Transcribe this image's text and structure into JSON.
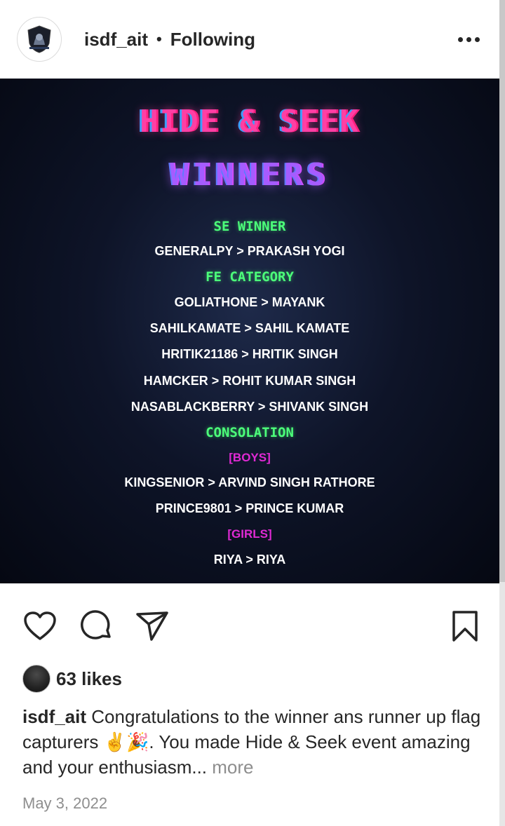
{
  "header": {
    "username": "isdf_ait",
    "separator": "•",
    "follow_status": "Following"
  },
  "post_image": {
    "title_line1": "HIDE & SEEK",
    "title_line2": "WINNERS",
    "colors": {
      "background": "#0e1428",
      "section_heading": "#4cff7a",
      "tag": "#e02ad4",
      "title_pink": "#ff3fa4",
      "title_purple": "#a55cff"
    },
    "lines": [
      {
        "text": "SE WINNER",
        "kind": "section"
      },
      {
        "text": "GENERALPY > PRAKASH YOGI",
        "kind": "entry"
      },
      {
        "text": "FE CATEGORY",
        "kind": "section"
      },
      {
        "text": "GOLIATHONE > MAYANK",
        "kind": "entry"
      },
      {
        "text": "SAHILKAMATE > SAHIL KAMATE",
        "kind": "entry"
      },
      {
        "text": "HRITIK21186 > HRITIK SINGH",
        "kind": "entry"
      },
      {
        "text": "HAMCKER > ROHIT KUMAR SINGH",
        "kind": "entry"
      },
      {
        "text": "NASABLACKBERRY > SHIVANK SINGH",
        "kind": "entry"
      },
      {
        "text": "CONSOLATION",
        "kind": "section"
      },
      {
        "text": "[BOYS]",
        "kind": "tag"
      },
      {
        "text": "KINGSENIOR > ARVIND SINGH RATHORE",
        "kind": "entry"
      },
      {
        "text": "PRINCE9801 > PRINCE KUMAR",
        "kind": "entry"
      },
      {
        "text": "[GIRLS]",
        "kind": "tag"
      },
      {
        "text": "RIYA > RIYA",
        "kind": "entry"
      }
    ]
  },
  "actions": {
    "icons": [
      "heart-icon",
      "comment-icon",
      "share-icon",
      "bookmark-icon"
    ]
  },
  "likes": {
    "text": "63 likes"
  },
  "caption": {
    "username": "isdf_ait",
    "text": " Congratulations to the winner ans runner up flag capturers ✌️🎉. You made Hide & Seek event amazing and your enthusiasm... ",
    "more": "more"
  },
  "date": "May 3, 2022"
}
